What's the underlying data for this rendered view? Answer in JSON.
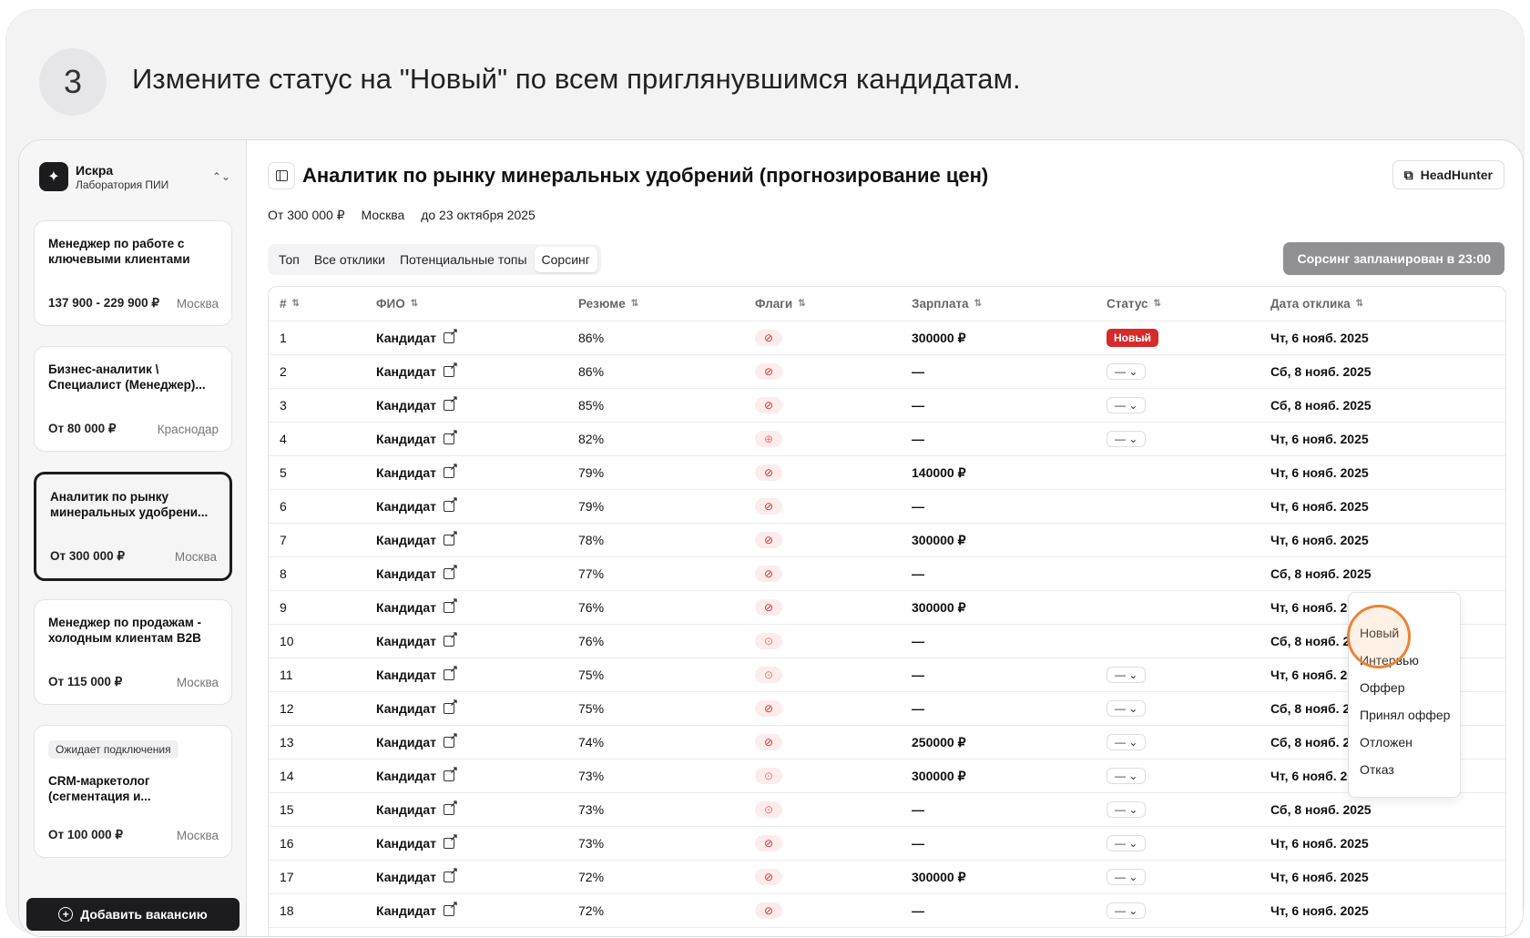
{
  "step": {
    "number": "3",
    "instruction": "Измените статус на \"Новый\" по всем приглянувшимся кандидатам."
  },
  "sidebar": {
    "org_name": "Искра",
    "org_sub": "Лаборатория ПИИ",
    "vacancies": [
      {
        "title": "Менеджер по работе с ключевыми клиентами",
        "salary": "137 900 - 229 900 ₽",
        "city": "Москва"
      },
      {
        "title": "Бизнес-аналитик \\ Специалист (Менеджер)...",
        "salary": "От 80 000 ₽",
        "city": "Краснодар"
      },
      {
        "title": "Аналитик по рынку минеральных удобрени...",
        "salary": "От 300 000 ₽",
        "city": "Москва"
      },
      {
        "title": "Менеджер по продажам - холодным клиентам B2B",
        "salary": "От 115 000 ₽",
        "city": "Москва"
      },
      {
        "badge": "Ожидает подключения",
        "title": "CRM-маркетолог (сегментация и...",
        "salary": "От 100 000 ₽",
        "city": "Москва"
      }
    ],
    "add_button": "Добавить вакансию"
  },
  "header": {
    "title": "Аналитик по рынку минеральных удобрений (прогнозирование цен)",
    "salary": "От 300 000 ₽",
    "city": "Москва",
    "deadline": "до 23 октября 2025",
    "hh_button": "HeadHunter",
    "sourcing_button": "Сорсинг запланирован в 23:00"
  },
  "tabs": [
    "Топ",
    "Все отклики",
    "Потенциальные топы",
    "Сорсинг"
  ],
  "table": {
    "columns": [
      "#",
      "ФИО",
      "Резюме",
      "Флаги",
      "Зарплата",
      "Статус",
      "Дата отклика"
    ],
    "rows": [
      {
        "n": "1",
        "name": "Кандидат",
        "resume": "86%",
        "salary": "300000 ₽",
        "status": "Новый",
        "date": "Чт, 6 нояб. 2025"
      },
      {
        "n": "2",
        "name": "Кандидат",
        "resume": "86%",
        "salary": "—",
        "status": "— ⌄",
        "date": "Сб, 8 нояб. 2025"
      },
      {
        "n": "3",
        "name": "Кандидат",
        "resume": "85%",
        "salary": "—",
        "status": "— ⌄",
        "date": "Сб, 8 нояб. 2025"
      },
      {
        "n": "4",
        "name": "Кандидат",
        "resume": "82%",
        "salary": "—",
        "status": "— ⌄",
        "date": "Чт, 6 нояб. 2025"
      },
      {
        "n": "5",
        "name": "Кандидат",
        "resume": "79%",
        "salary": "140000 ₽",
        "status": "",
        "date": "Чт, 6 нояб. 2025"
      },
      {
        "n": "6",
        "name": "Кандидат",
        "resume": "79%",
        "salary": "—",
        "status": "",
        "date": "Чт, 6 нояб. 2025"
      },
      {
        "n": "7",
        "name": "Кандидат",
        "resume": "78%",
        "salary": "300000 ₽",
        "status": "",
        "date": "Чт, 6 нояб. 2025"
      },
      {
        "n": "8",
        "name": "Кандидат",
        "resume": "77%",
        "salary": "—",
        "status": "",
        "date": "Сб, 8 нояб. 2025"
      },
      {
        "n": "9",
        "name": "Кандидат",
        "resume": "76%",
        "salary": "300000 ₽",
        "status": "",
        "date": "Чт, 6 нояб. 2025"
      },
      {
        "n": "10",
        "name": "Кандидат",
        "resume": "76%",
        "salary": "—",
        "status": "",
        "date": "Сб, 8 нояб. 2025"
      },
      {
        "n": "11",
        "name": "Кандидат",
        "resume": "75%",
        "salary": "—",
        "status": "— ⌄",
        "date": "Чт, 6 нояб. 2025"
      },
      {
        "n": "12",
        "name": "Кандидат",
        "resume": "75%",
        "salary": "—",
        "status": "— ⌄",
        "date": "Сб, 8 нояб. 2025"
      },
      {
        "n": "13",
        "name": "Кандидат",
        "resume": "74%",
        "salary": "250000 ₽",
        "status": "— ⌄",
        "date": "Сб, 8 нояб. 2025"
      },
      {
        "n": "14",
        "name": "Кандидат",
        "resume": "73%",
        "salary": "300000 ₽",
        "status": "— ⌄",
        "date": "Чт, 6 нояб. 2025"
      },
      {
        "n": "15",
        "name": "Кандидат",
        "resume": "73%",
        "salary": "—",
        "status": "— ⌄",
        "date": "Сб, 8 нояб. 2025"
      },
      {
        "n": "16",
        "name": "Кандидат",
        "resume": "73%",
        "salary": "—",
        "status": "— ⌄",
        "date": "Чт, 6 нояб. 2025"
      },
      {
        "n": "17",
        "name": "Кандидат",
        "resume": "72%",
        "salary": "300000 ₽",
        "status": "— ⌄",
        "date": "Чт, 6 нояб. 2025"
      },
      {
        "n": "18",
        "name": "Кандидат",
        "resume": "72%",
        "salary": "—",
        "status": "— ⌄",
        "date": "Чт, 6 нояб. 2025"
      }
    ]
  },
  "dropdown": {
    "items": [
      "Новый",
      "Интервью",
      "Оффер",
      "Принял оффер",
      "Отложен",
      "Отказ"
    ]
  },
  "colors": {
    "status_new": "#d62b2b",
    "highlight": "#e8843a",
    "dark": "#1c1c1e"
  }
}
